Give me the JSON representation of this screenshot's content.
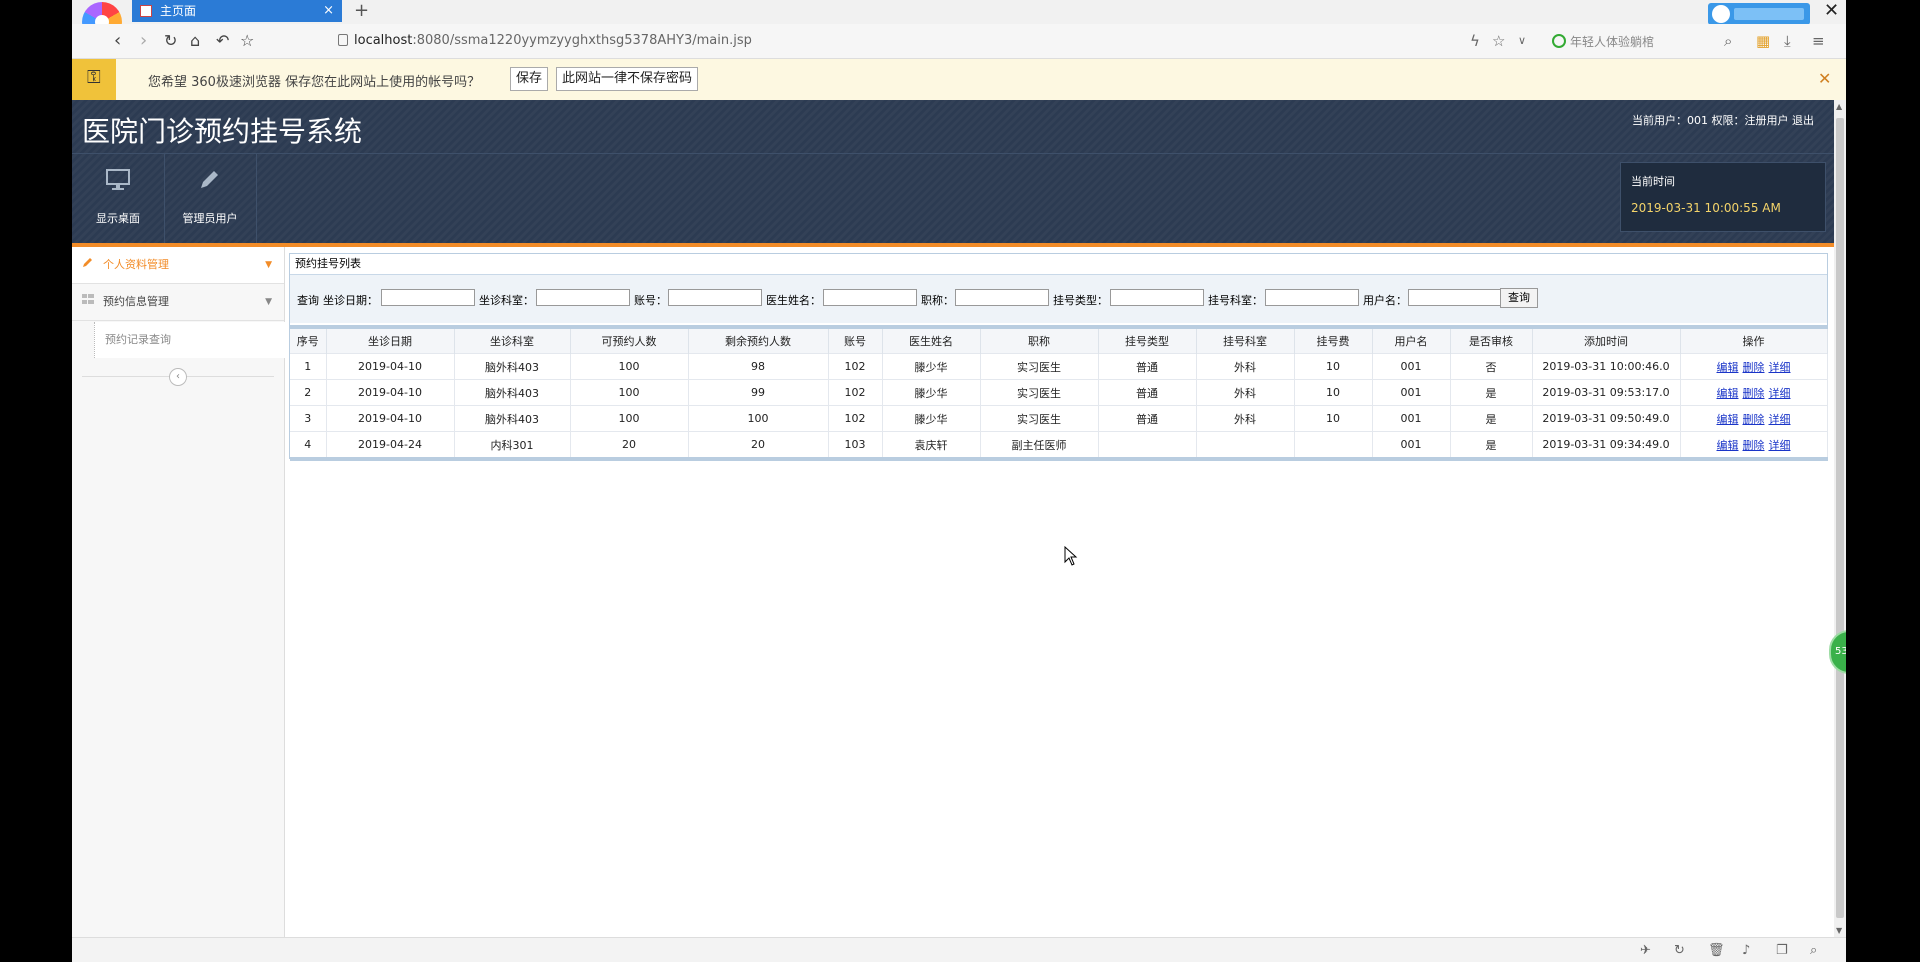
{
  "browser": {
    "tab_title": "主页面",
    "tab_close": "×",
    "new_tab": "+",
    "url_host": "localhost",
    "url_rest": ":8080/ssma1220yymzyyghxthsg5378AHY3/main.jsp",
    "search_hint": "年轻人体验躺棺",
    "window_close": "✕"
  },
  "password_bar": {
    "message": "您希望 360极速浏览器 保存您在此网站上使用的帐号吗？",
    "save_label": "保存",
    "never_label": "此网站一律不保存密码",
    "close": "✕"
  },
  "app": {
    "title": "医院门诊预约挂号系统",
    "user_info": "当前用户：001 权限：注册用户  退出",
    "menus": [
      {
        "label": "显示桌面",
        "icon": "monitor-icon"
      },
      {
        "label": "管理员用户",
        "icon": "pencil-icon"
      }
    ],
    "time_label": "当前时间",
    "time_value": "2019-03-31 10:00:55 AM"
  },
  "sidebar": {
    "items": [
      {
        "label": "个人资料管理",
        "active": true
      },
      {
        "label": "预约信息管理",
        "active": false
      }
    ],
    "sub_items": [
      {
        "label": "预约记录查询"
      }
    ]
  },
  "panel": {
    "title": "预约挂号列表",
    "query": {
      "prefix": "查询",
      "fields": [
        "坐诊日期：",
        "坐诊科室：",
        "账号：",
        "医生姓名：",
        "职称：",
        "挂号类型：",
        "挂号科室：",
        "用户名："
      ],
      "button": "查询"
    },
    "columns": [
      "序号",
      "坐诊日期",
      "坐诊科室",
      "可预约人数",
      "剩余预约人数",
      "账号",
      "医生姓名",
      "职称",
      "挂号类型",
      "挂号科室",
      "挂号费",
      "用户名",
      "是否审核",
      "添加时间",
      "操作"
    ],
    "rows": [
      [
        "1",
        "2019-04-10",
        "脑外科403",
        "100",
        "98",
        "102",
        "滕少华",
        "实习医生",
        "普通",
        "外科",
        "10",
        "001",
        "否",
        "2019-03-31 10:00:46.0"
      ],
      [
        "2",
        "2019-04-10",
        "脑外科403",
        "100",
        "99",
        "102",
        "滕少华",
        "实习医生",
        "普通",
        "外科",
        "10",
        "001",
        "是",
        "2019-03-31 09:53:17.0"
      ],
      [
        "3",
        "2019-04-10",
        "脑外科403",
        "100",
        "100",
        "102",
        "滕少华",
        "实习医生",
        "普通",
        "外科",
        "10",
        "001",
        "是",
        "2019-03-31 09:50:49.0"
      ],
      [
        "4",
        "2019-04-24",
        "内科301",
        "20",
        "20",
        "103",
        "袁庆轩",
        "副主任医师",
        "",
        "",
        "",
        "001",
        "是",
        "2019-03-31 09:34:49.0"
      ]
    ],
    "actions": [
      "编辑",
      "删除",
      "详细"
    ]
  },
  "float_badge": "53",
  "colors": {
    "header_bg": "#2c3b52",
    "accent_orange": "#f28c28",
    "tab_blue": "#2b7bd6",
    "link_blue": "#1a35c8",
    "time_yellow": "#f4d46a"
  }
}
